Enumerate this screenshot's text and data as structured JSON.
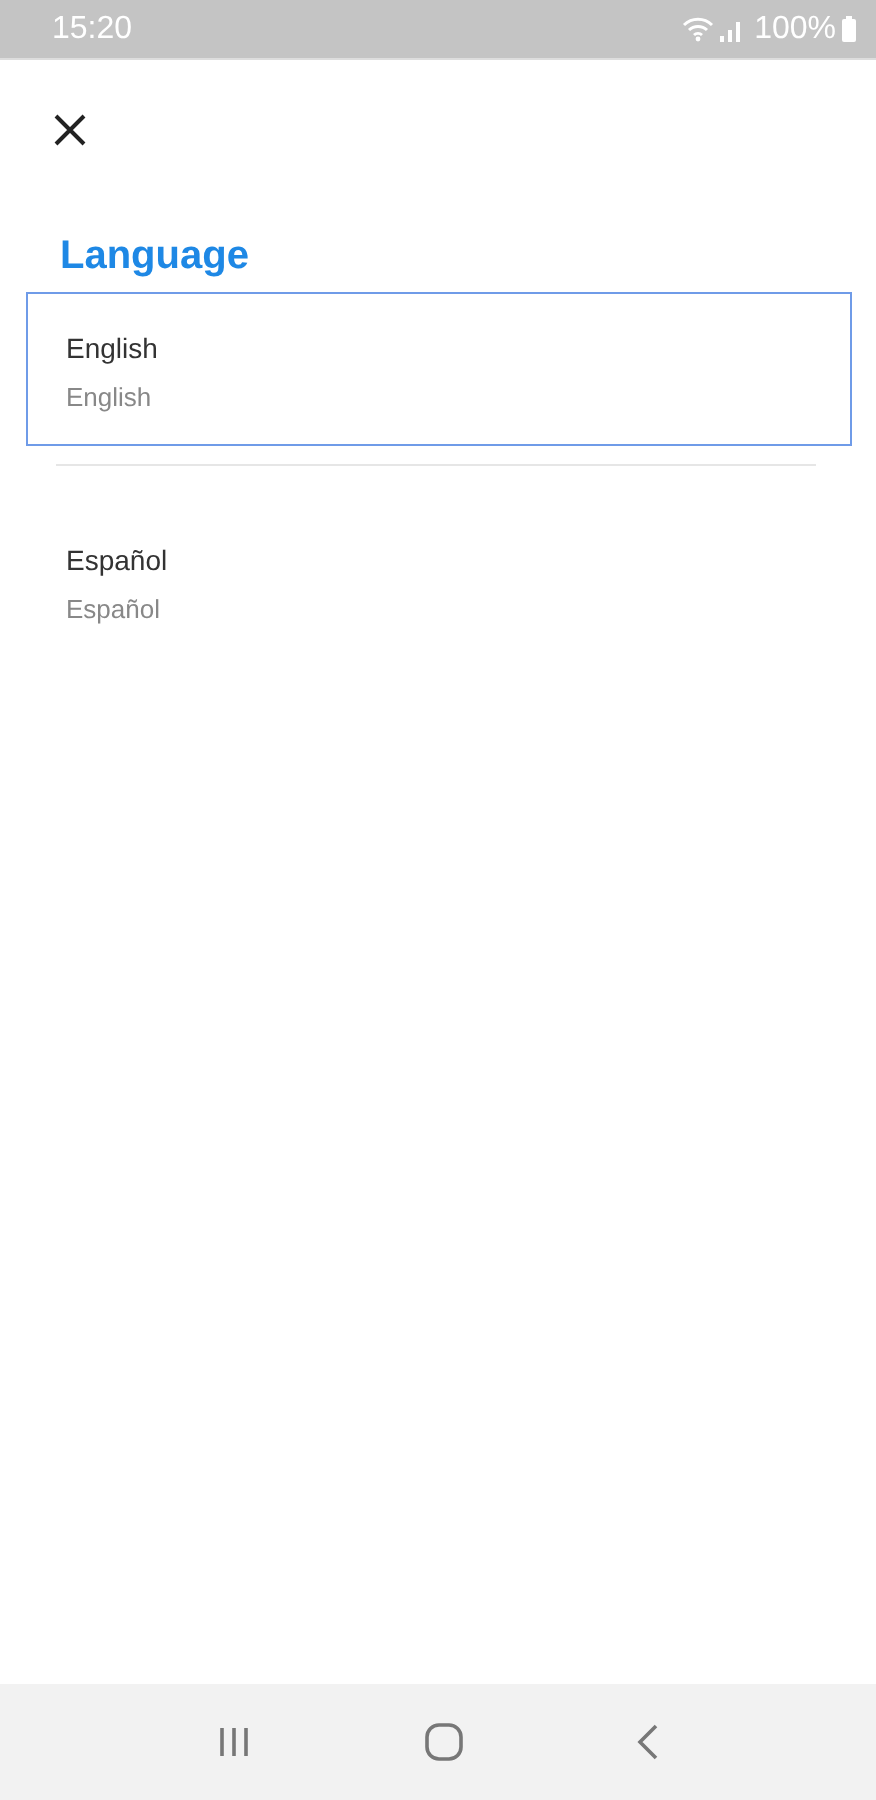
{
  "status_bar": {
    "time": "15:20",
    "battery": "100%"
  },
  "title": "Language",
  "languages": [
    {
      "name": "English",
      "native": "English",
      "selected": true
    },
    {
      "name": "Español",
      "native": "Español",
      "selected": false
    }
  ]
}
